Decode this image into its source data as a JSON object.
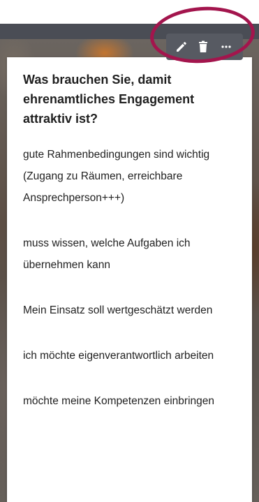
{
  "card": {
    "title": "Was brauchen Sie, damit ehrenamtliches Engagement attraktiv ist?",
    "entries": [
      "gute Rahmenbedingungen sind wichtig (Zugang zu Räumen, erreichbare Ansprechperson+++)",
      "muss wissen, welche Aufgaben ich übernehmen kann",
      "Mein Einsatz soll wertgeschätzt werden",
      "ich möchte eigenverantwortlich arbeiten",
      "möchte meine Kompetenzen einbringen"
    ]
  },
  "toolbar": {
    "edit_icon": "pencil-icon",
    "delete_icon": "trash-icon",
    "more_icon": "more-horizontal-icon"
  },
  "colors": {
    "toolbar_bg": "#575a62",
    "highlight_ring": "#a3154d",
    "card_bg": "#ffffff",
    "text": "#222222"
  }
}
